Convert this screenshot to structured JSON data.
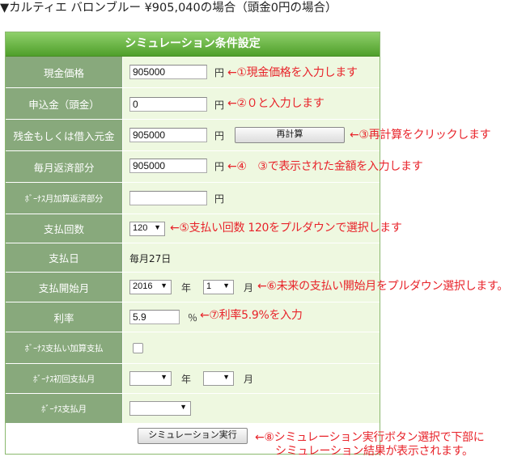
{
  "title": "▼カルティエ バロンブルー ¥905,040の場合（頭金0円の場合）",
  "panel_header": "シミュレーション条件設定",
  "rows": {
    "price": {
      "label": "現金価格",
      "value": "905000",
      "unit": "円",
      "note": "←①現金価格を入力します"
    },
    "down": {
      "label": "申込金（頭金）",
      "value": "0",
      "unit": "円",
      "note": "←②０と入力します"
    },
    "loan": {
      "label": "残金もしくは借入元金",
      "value": "905000",
      "unit": "円",
      "button": "再計算",
      "note": "←③再計算をクリックします"
    },
    "monthly": {
      "label": "毎月返済部分",
      "value": "905000",
      "unit": "円",
      "note": "←④　③で表示された金額を入力します"
    },
    "bonus_add": {
      "label": "ﾎﾞｰﾅｽ月加算返済部分",
      "value": "",
      "unit": "円"
    },
    "count": {
      "label": "支払回数",
      "value": "120",
      "note": "←⑤支払い回数 120をプルダウンで選択します"
    },
    "pay_day": {
      "label": "支払日",
      "value": "毎月27日"
    },
    "start": {
      "label": "支払開始月",
      "year": "2016",
      "year_unit": "年",
      "month": "1",
      "month_unit": "月",
      "note": "←⑥未来の支払い開始月をプルダウン選択します。"
    },
    "rate": {
      "label": "利率",
      "value": "5.9",
      "unit": "％",
      "note": "←⑦利率5.9%を入力"
    },
    "bonus_pay": {
      "label": "ﾎﾞｰﾅｽ支払い加算支払"
    },
    "bonus_first": {
      "label": "ﾎﾞｰﾅｽ初回支払月",
      "year": "",
      "year_unit": "年",
      "month": "",
      "month_unit": "月"
    },
    "bonus_month": {
      "label": "ﾎﾞｰﾅｽ支払月",
      "value": ""
    }
  },
  "run_button": "シミュレーション実行",
  "run_note_line1": "←⑧シミュレーション実行ボタン選択で下部に",
  "run_note_line2": "シミュレーション結果が表示されます。"
}
